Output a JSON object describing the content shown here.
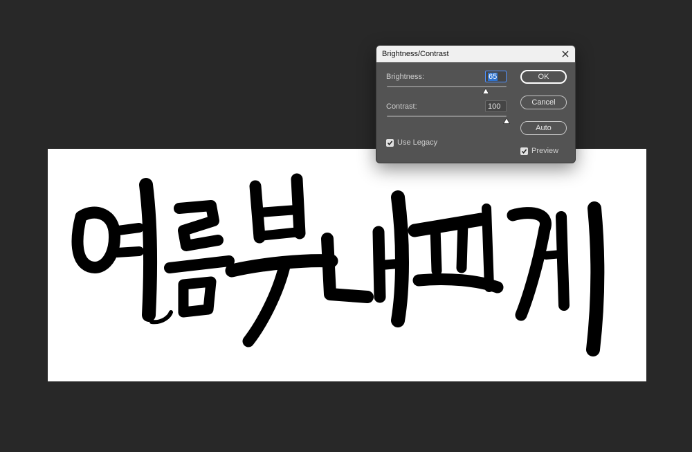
{
  "dialog": {
    "title": "Brightness/Contrast",
    "brightness": {
      "label": "Brightness:",
      "value": "65",
      "slider_fraction": 0.79
    },
    "contrast": {
      "label": "Contrast:",
      "value": "100",
      "slider_fraction": 0.97
    },
    "use_legacy": {
      "label": "Use Legacy",
      "checked": true
    },
    "preview": {
      "label": "Preview",
      "checked": true
    },
    "buttons": {
      "ok": "OK",
      "cancel": "Cancel",
      "auto": "Auto"
    }
  },
  "colors": {
    "workspace": "#282828",
    "dialog_bg": "#535353",
    "titlebar_bg": "#f0f0f0",
    "ink": "#000000",
    "accent": "#4d90fe"
  }
}
